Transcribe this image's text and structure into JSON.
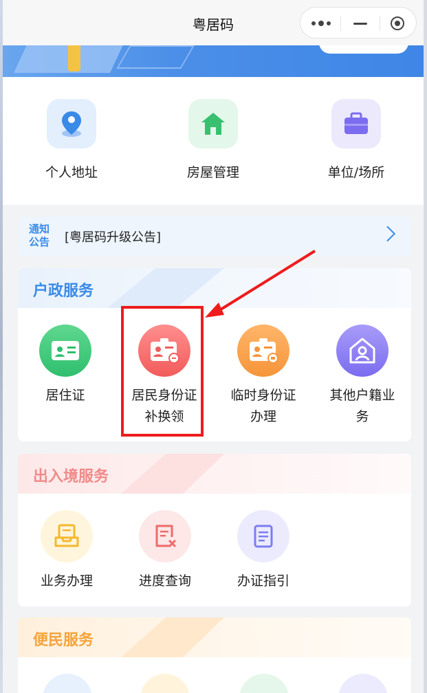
{
  "window": {
    "title": "粤居码"
  },
  "quick_actions": [
    {
      "label": "个人地址",
      "icon": "location-pin-icon"
    },
    {
      "label": "房屋管理",
      "icon": "house-icon"
    },
    {
      "label": "单位/场所",
      "icon": "briefcase-icon"
    }
  ],
  "notice": {
    "tag_line1": "通知",
    "tag_line2": "公告",
    "text": "[粤居码升级公告]"
  },
  "household": {
    "title": "户政服务",
    "items": [
      {
        "line1": "居住证",
        "line2": "",
        "icon": "residence-card-icon",
        "color": "#2fbf6e"
      },
      {
        "line1": "居民身份证",
        "line2": "补换领",
        "icon": "id-card-replace-icon",
        "color": "#f25b5b"
      },
      {
        "line1": "临时身份证",
        "line2": "办理",
        "icon": "temp-id-card-icon",
        "color": "#f5953a"
      },
      {
        "line1": "其他户籍业",
        "line2": "务",
        "icon": "household-icon",
        "color": "#8a7cf0"
      }
    ]
  },
  "exit_entry": {
    "title": "出入境服务",
    "items": [
      {
        "label": "业务办理",
        "icon": "inbox-tray-icon"
      },
      {
        "label": "进度查询",
        "icon": "progress-doc-icon"
      },
      {
        "label": "办证指引",
        "icon": "guide-doc-icon"
      }
    ]
  },
  "convenience": {
    "title": "便民服务"
  },
  "colors": {
    "accent_blue": "#3a8ae8",
    "highlight_red": "#ee1c1c",
    "exit_title": "#f08a8a",
    "conv_title": "#f5a33a"
  }
}
